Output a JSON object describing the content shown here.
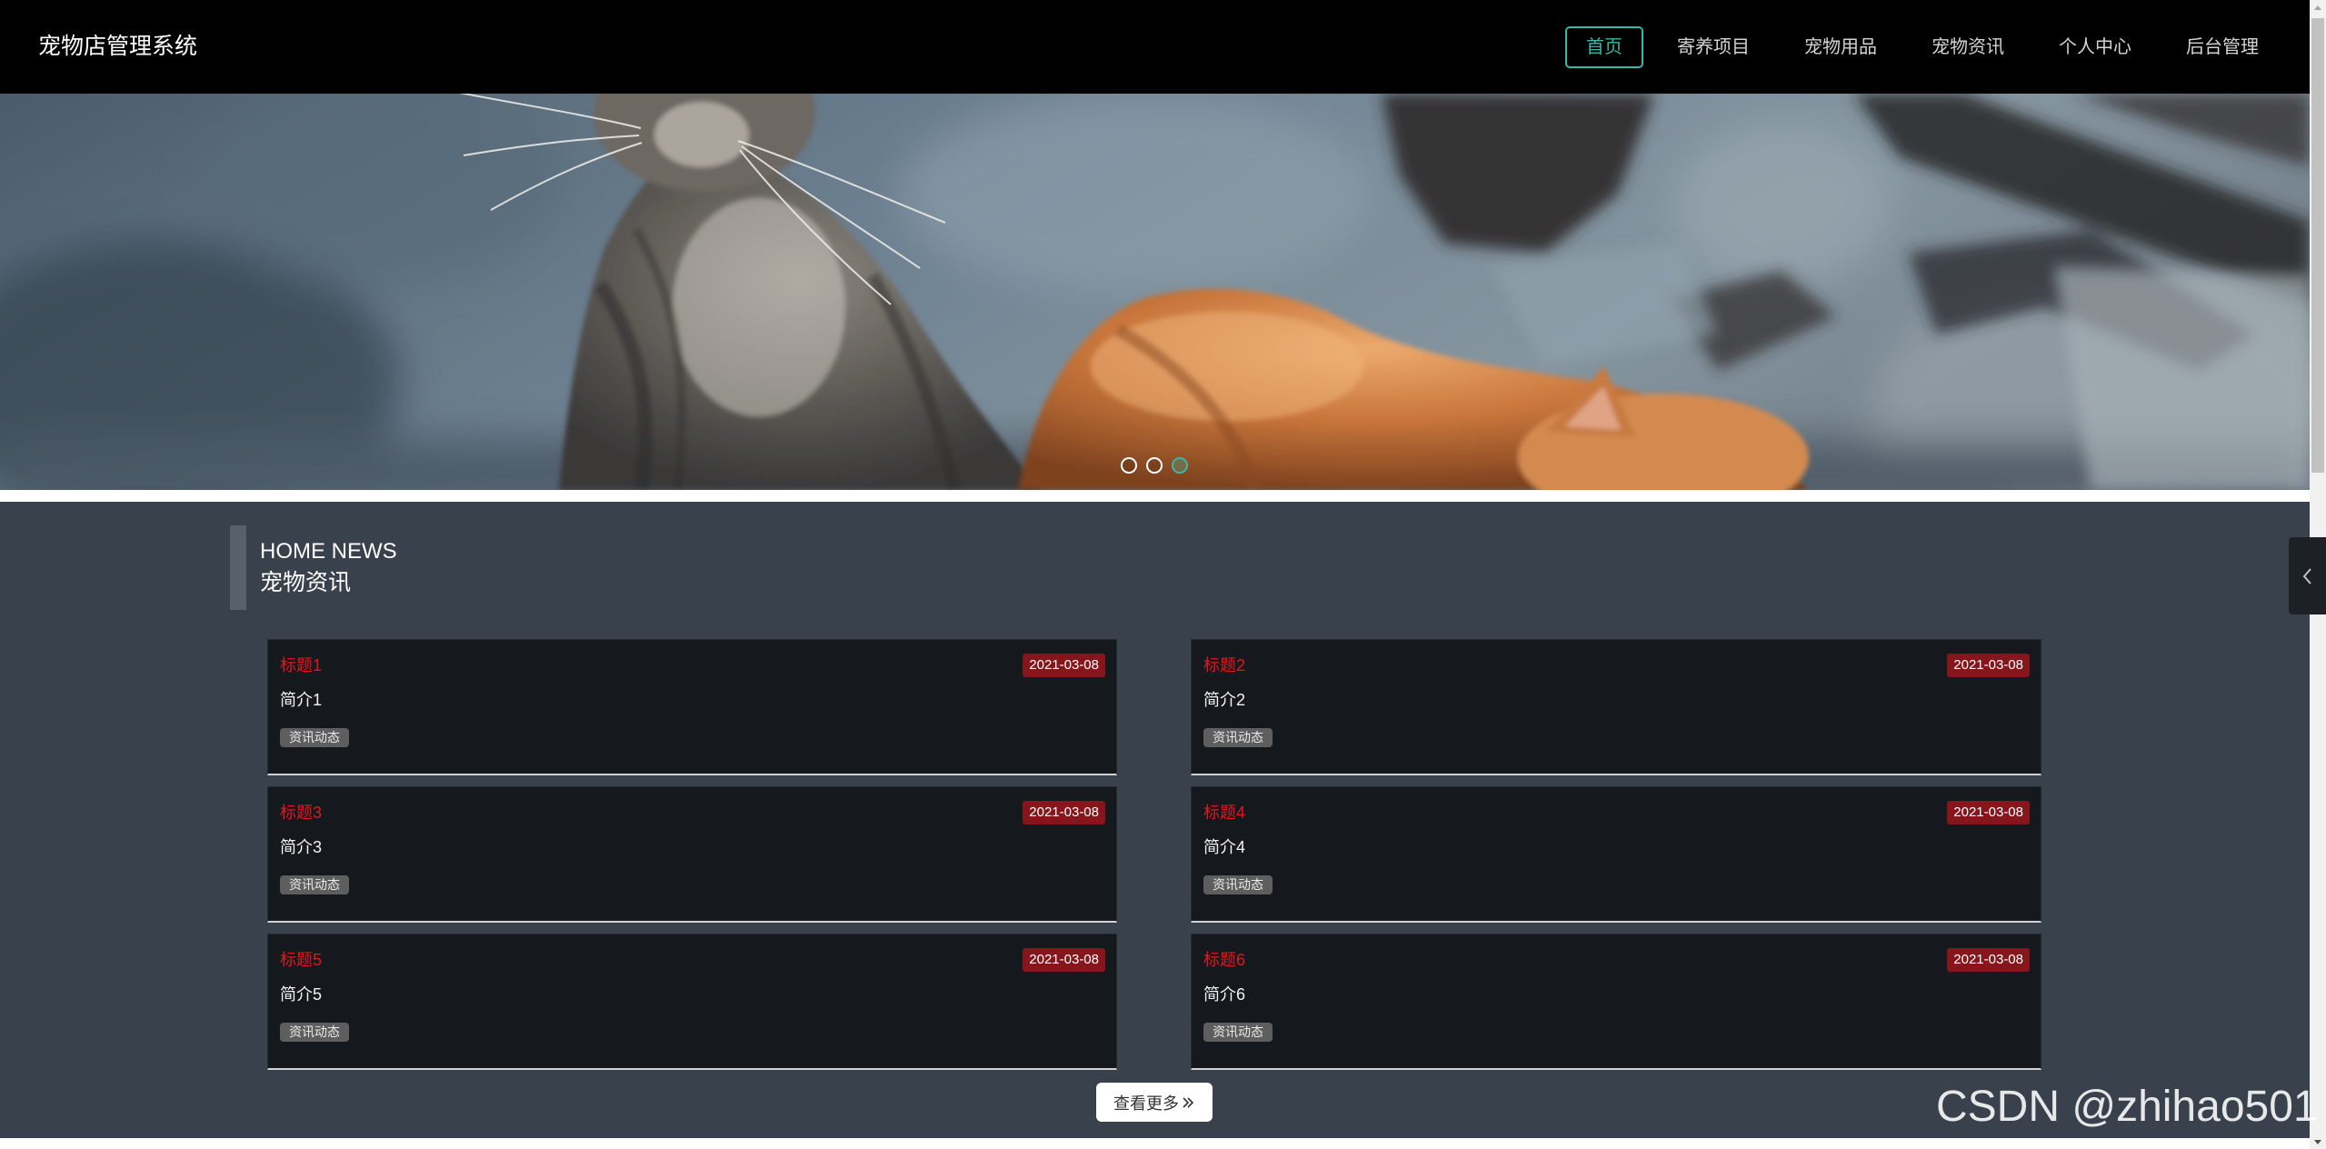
{
  "app": {
    "title": "宠物店管理系统"
  },
  "nav": {
    "items": [
      {
        "label": "首页",
        "active": true
      },
      {
        "label": "寄养项目",
        "active": false
      },
      {
        "label": "宠物用品",
        "active": false
      },
      {
        "label": "宠物资讯",
        "active": false
      },
      {
        "label": "个人中心",
        "active": false
      },
      {
        "label": "后台管理",
        "active": false
      }
    ]
  },
  "banner": {
    "slide_count": 3,
    "active_slide": 3
  },
  "news": {
    "heading_en": "HOME NEWS",
    "heading_cn": "宠物资讯",
    "items": [
      {
        "title": "标题1",
        "date": "2021-03-08",
        "summary": "简介1",
        "tag": "资讯动态"
      },
      {
        "title": "标题2",
        "date": "2021-03-08",
        "summary": "简介2",
        "tag": "资讯动态"
      },
      {
        "title": "标题3",
        "date": "2021-03-08",
        "summary": "简介3",
        "tag": "资讯动态"
      },
      {
        "title": "标题4",
        "date": "2021-03-08",
        "summary": "简介4",
        "tag": "资讯动态"
      },
      {
        "title": "标题5",
        "date": "2021-03-08",
        "summary": "简介5",
        "tag": "资讯动态"
      },
      {
        "title": "标题6",
        "date": "2021-03-08",
        "summary": "简介6",
        "tag": "资讯动态"
      }
    ],
    "more_label": "查看更多"
  },
  "watermark": "CSDN @zhihao501",
  "icons": {
    "more_button": "double-chevron-right-icon",
    "side_tab": "chevron-left-icon"
  },
  "colors": {
    "nav_bg": "#000000",
    "accent": "#36b9a7",
    "section_bg": "#39424c",
    "card_bg": "#15191e",
    "title_red": "#e0171f",
    "date_badge_bg": "#86161b",
    "tag_bg": "#5e5e5e"
  }
}
